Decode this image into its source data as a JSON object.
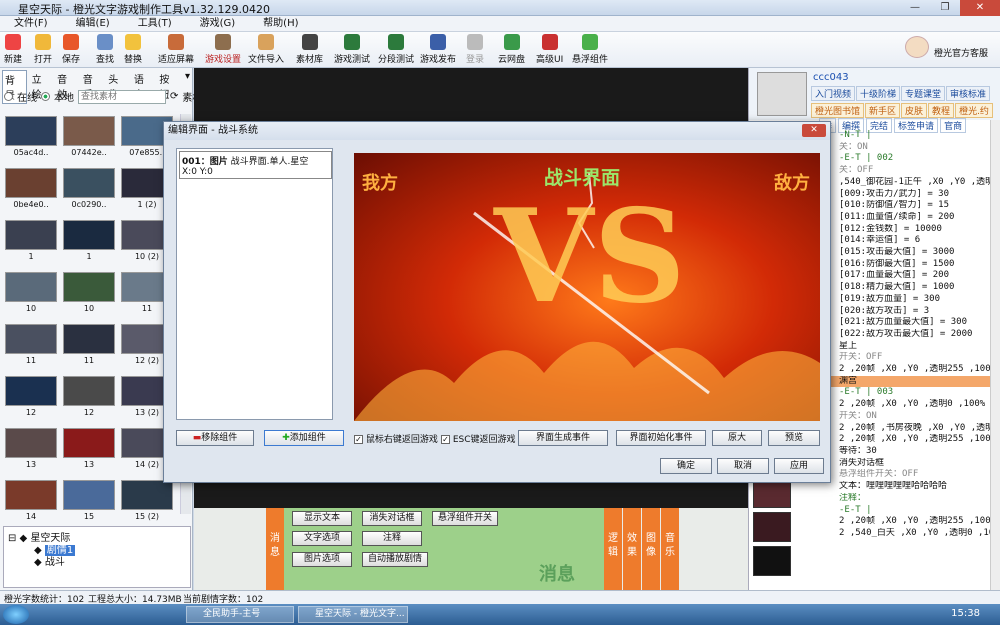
{
  "window": {
    "title": "星空天际 - 橙光文字游戏制作工具v1.32.129.0420",
    "minimize": "—",
    "restore": "❐",
    "close": "✕"
  },
  "menu": [
    "文件(F)",
    "编辑(E)",
    "工具(T)",
    "游戏(G)",
    "帮助(H)"
  ],
  "toolbar": [
    "新建",
    "打开",
    "保存",
    "查找",
    "替换",
    "适应屏幕",
    "游戏设置",
    "文件导入",
    "素材库",
    "游戏测试",
    "分段测试",
    "游戏发布",
    "登录",
    "云网盘",
    "高级UI",
    "悬浮组件"
  ],
  "service": "橙光官方客服",
  "left": {
    "tabs": [
      "背景",
      "立绘",
      "音效",
      "音乐",
      "头像",
      "语音",
      "按钮"
    ],
    "source_online": "在线",
    "source_local": "本地",
    "search_placeholder": "查找素材",
    "material": "素材",
    "thumbs": [
      "05ac4d..",
      "07442e..",
      "07e855..",
      "0be4e0..",
      "0c0290..",
      "1 (2)",
      "1",
      "1",
      "10 (2)",
      "10",
      "10",
      "11",
      "11",
      "11",
      "12 (2)",
      "12",
      "12",
      "13 (2)",
      "13",
      "13",
      "14 (2)",
      "14",
      "15",
      "15 (2)"
    ],
    "tree": {
      "root": "星空天际",
      "child1": "剧情1",
      "child2": "战斗"
    }
  },
  "status": {
    "chars": "橙光字数统计：102",
    "size": "工程总大小：14.73MB",
    "current": "当前剧情字数：102"
  },
  "taskbar": {
    "task1": "全民助手-主号",
    "task2": "星空天际 - 橙光文字...",
    "clock": "15:38"
  },
  "commands": {
    "buttons": [
      "显示文本",
      "消失对话框",
      "悬浮组件开关",
      "文字选项",
      "注释",
      "图片选项",
      "自动播放剧情"
    ],
    "tab_msg": "消息",
    "tabs_right": [
      "逻辑",
      "效果",
      "图像",
      "音乐"
    ],
    "big": "消息"
  },
  "right": {
    "user": "ccc043",
    "links": [
      "入门视频",
      "十级阶梯",
      "专题课堂",
      "审核标准",
      "橙光图书馆",
      "新手区",
      "皮肤",
      "教程",
      "橙光.约"
    ],
    "links2": [
      "季",
      "编撰",
      "完结",
      "标签申请",
      "官商"
    ],
    "script": [
      {
        "t": "-N-T |",
        "c": "grn"
      },
      {
        "t": "关：ON",
        "c": "gry"
      },
      {
        "t": "-E-T | 002",
        "c": "grn"
      },
      {
        "t": "关：OFF",
        "c": "gry"
      },
      {
        "t": ",540_御花园-1正午 ,X0 ,Y0 ,透明0 ,1",
        "c": ""
      },
      {
        "t": "[009:攻击力/武力] = 30",
        "c": ""
      },
      {
        "t": "[010:防御值/智力] = 15",
        "c": ""
      },
      {
        "t": "[011:血量值/续命] = 200",
        "c": ""
      },
      {
        "t": "[012:金钱数] = 10000",
        "c": ""
      },
      {
        "t": "[014:幸运值] = 6",
        "c": ""
      },
      {
        "t": "[015:攻击最大值] = 3000",
        "c": ""
      },
      {
        "t": "[016:防御最大值] = 1500",
        "c": ""
      },
      {
        "t": "[017:血量最大值] = 200",
        "c": ""
      },
      {
        "t": "[018:精力最大值] = 1000",
        "c": ""
      },
      {
        "t": "[019:敌方血量] = 300",
        "c": ""
      },
      {
        "t": "[020:敌方攻击] = 3",
        "c": ""
      },
      {
        "t": "[021:敌方血量最大值] = 300",
        "c": ""
      },
      {
        "t": "[022:敌方攻击最大值] = 2000",
        "c": ""
      },
      {
        "t": "星上",
        "c": ""
      },
      {
        "t": "开关：OFF",
        "c": "gry"
      },
      {
        "t": "2 ,20帧 ,X0 ,Y0 ,透明255 ,100% ,100%",
        "c": ""
      },
      {
        "t": "",
        "c": ""
      },
      {
        "t": "渊宫",
        "c": "hl"
      },
      {
        "t": "-E-T | 003",
        "c": "grn"
      },
      {
        "t": "2 ,20帧 ,X0 ,Y0 ,透明0 ,100% ,100%",
        "c": ""
      },
      {
        "t": "",
        "c": ""
      },
      {
        "t": "开关：ON",
        "c": "gry"
      },
      {
        "t": "2 ,20帧 ,书房夜晚 ,X0 ,Y0 ,透明255 ,100%",
        "c": ""
      },
      {
        "t": "2 ,20帧 ,X0 ,Y0 ,透明255 ,100% ,100%",
        "c": ""
      },
      {
        "t": "",
        "c": ""
      },
      {
        "t": "等待：30",
        "c": ""
      },
      {
        "t": "消失对话框",
        "c": ""
      },
      {
        "t": "悬浮组件开关：OFF",
        "c": "gry"
      },
      {
        "t": "文本：哩哩哩哩哩哈哈哈哈",
        "c": ""
      },
      {
        "t": "注释：",
        "c": "grn"
      },
      {
        "t": "-E-T |",
        "c": "grn"
      },
      {
        "t": "2 ,20帧 ,X0 ,Y0 ,透明255 ,100% ,100%",
        "c": ""
      },
      {
        "t": "",
        "c": ""
      },
      {
        "t": "2 ,540_白天 ,X0 ,Y0 ,透明0 ,100% ,100%",
        "c": ""
      }
    ]
  },
  "dialog": {
    "title": "编辑界面 - 战斗系统",
    "close": "✕",
    "item_title": "001：图片",
    "item_desc": "战斗界面.单人.星空",
    "item_coords": "X:0  Y:0",
    "preview_left": "我方",
    "preview_center": "战斗界面",
    "preview_right": "敌方",
    "preview_vs": "VS",
    "remove": "移除组件",
    "add": "添加组件",
    "chk_right": "鼠标右键返回游戏",
    "chk_esc": "ESC键返回游戏",
    "gen": "界面生成事件",
    "init": "界面初始化事件",
    "orig": "原大",
    "preview": "预览",
    "ok": "确定",
    "cancel": "取消",
    "apply": "应用"
  }
}
